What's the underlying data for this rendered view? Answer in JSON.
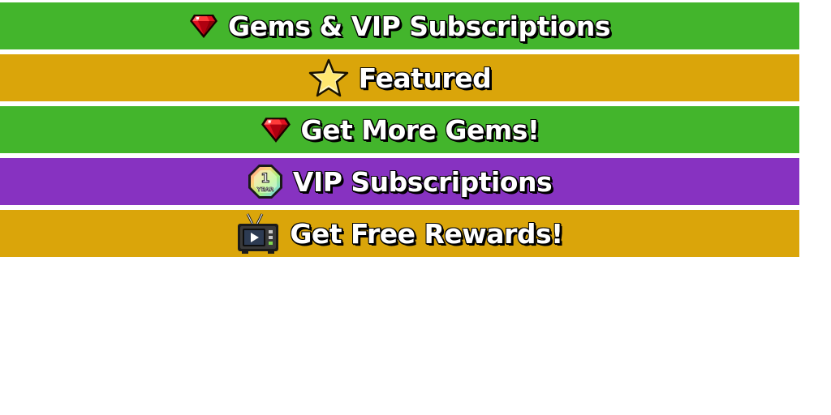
{
  "colors": {
    "green": "#43b52c",
    "gold": "#daa50a",
    "purple": "#8732c1"
  },
  "menu": {
    "items": [
      {
        "label": "Gems & VIP Subscriptions",
        "icon": "gem-icon",
        "color": "#43b52c"
      },
      {
        "label": "Featured",
        "icon": "star-icon",
        "color": "#daa50a"
      },
      {
        "label": "Get More Gems!",
        "icon": "gem-icon",
        "color": "#43b52c"
      },
      {
        "label": "VIP Subscriptions",
        "icon": "one-year-badge-icon",
        "badge_text": "YEAR",
        "badge_number": "1",
        "color": "#8732c1"
      },
      {
        "label": "Get Free Rewards!",
        "icon": "tv-icon",
        "color": "#daa50a"
      }
    ]
  }
}
